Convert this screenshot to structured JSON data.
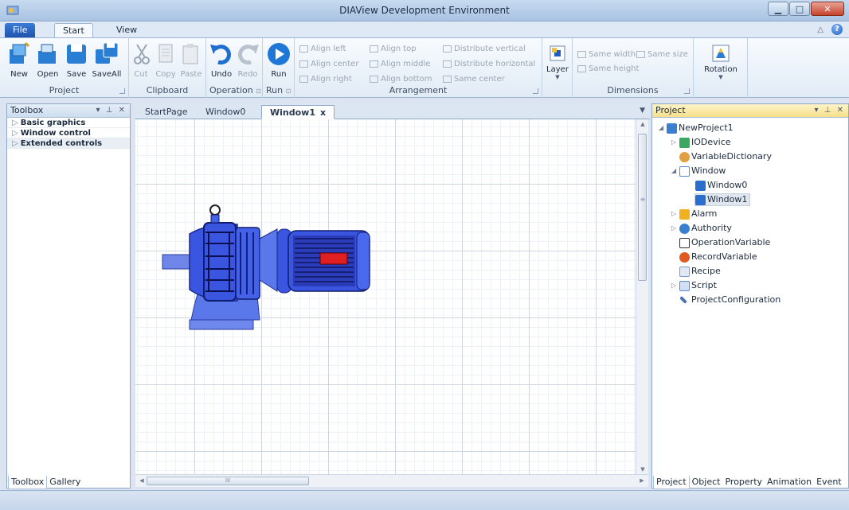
{
  "window": {
    "title": "DIAView Development Environment"
  },
  "menu": {
    "file": "File",
    "start": "Start",
    "view": "View"
  },
  "ribbon": {
    "project": {
      "label": "Project",
      "new": "New",
      "open": "Open",
      "save": "Save",
      "saveall": "SaveAll"
    },
    "clipboard": {
      "label": "Clipboard",
      "cut": "Cut",
      "copy": "Copy",
      "paste": "Paste"
    },
    "operation": {
      "label": "Operation",
      "undo": "Undo",
      "redo": "Redo"
    },
    "run": {
      "label": "Run",
      "run": "Run"
    },
    "arrangement": {
      "label": "Arrangement",
      "align_left": "Align left",
      "align_center": "Align center",
      "align_right": "Align right",
      "align_top": "Align top",
      "align_middle": "Align middle",
      "align_bottom": "Align bottom",
      "distribute_vertical": "Distribute vertical",
      "distribute_horizontal": "Distribute horizontal",
      "same_center": "Same center",
      "layer": "Layer"
    },
    "dimensions": {
      "label": "Dimensions",
      "same_width": "Same width",
      "same_size": "Same size",
      "same_height": "Same height"
    },
    "rotation": {
      "rotation": "Rotation"
    }
  },
  "toolbox": {
    "title": "Toolbox",
    "items": [
      "Basic graphics",
      "Window control",
      "Extended controls"
    ],
    "bottom_tabs": [
      "Toolbox",
      "Gallery"
    ]
  },
  "documents": {
    "tabs": [
      "StartPage",
      "Window0",
      "Window1"
    ],
    "close_glyph": "x",
    "scroll_glyph": "III"
  },
  "project": {
    "title": "Project",
    "tree": {
      "root": "NewProject1",
      "iodevice": "IODevice",
      "variabledictionary": "VariableDictionary",
      "window": "Window",
      "window0": "Window0",
      "window1": "Window1",
      "alarm": "Alarm",
      "authority": "Authority",
      "operationvariable": "OperationVariable",
      "recordvariable": "RecordVariable",
      "recipe": "Recipe",
      "script": "Script",
      "projectconfiguration": "ProjectConfiguration"
    },
    "bottom_tabs": [
      "Project",
      "Object",
      "Property",
      "Animation",
      "Event"
    ]
  },
  "colors": {
    "accent": "#1f54ac",
    "motor_blue": "#3a55e0",
    "indicator_red": "#e02020"
  }
}
